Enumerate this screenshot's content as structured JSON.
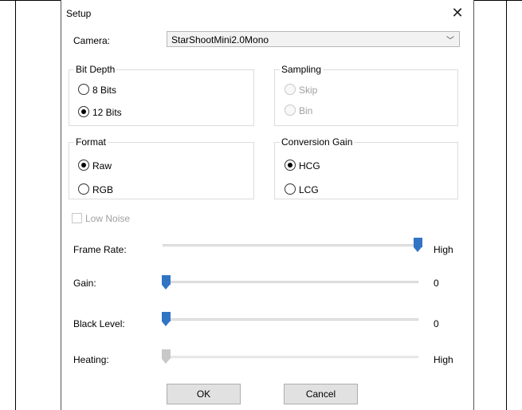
{
  "dialog": {
    "title": "Setup"
  },
  "camera": {
    "label": "Camera:",
    "selected": "StarShootMini2.0Mono"
  },
  "bit_depth": {
    "title": "Bit Depth",
    "options": [
      {
        "label": "8 Bits",
        "checked": false
      },
      {
        "label": "12 Bits",
        "checked": true
      }
    ]
  },
  "sampling": {
    "title": "Sampling",
    "options": [
      {
        "label": "Skip",
        "checked": false,
        "enabled": false
      },
      {
        "label": "Bin",
        "checked": false,
        "enabled": false
      }
    ]
  },
  "format": {
    "title": "Format",
    "options": [
      {
        "label": "Raw",
        "checked": true
      },
      {
        "label": "RGB",
        "checked": false
      }
    ]
  },
  "conversion_gain": {
    "title": "Conversion Gain",
    "options": [
      {
        "label": "HCG",
        "checked": true
      },
      {
        "label": "LCG",
        "checked": false
      }
    ]
  },
  "low_noise": {
    "label": "Low Noise",
    "checked": false,
    "enabled": false
  },
  "sliders": [
    {
      "label": "Frame Rate:",
      "value_text": "High",
      "position": 1.0,
      "enabled": true
    },
    {
      "label": "Gain:",
      "value_text": "0",
      "position": 0.0,
      "enabled": true
    },
    {
      "label": "Black Level:",
      "value_text": "0",
      "position": 0.0,
      "enabled": true
    },
    {
      "label": "Heating:",
      "value_text": "High",
      "position": 0.0,
      "enabled": false
    }
  ],
  "buttons": {
    "ok": "OK",
    "cancel": "Cancel"
  },
  "icons": {
    "close": "close-icon",
    "dropdown": "chevron-down-icon"
  },
  "colors": {
    "accent": "#3174c4",
    "disabled": "#a0a0a0"
  }
}
